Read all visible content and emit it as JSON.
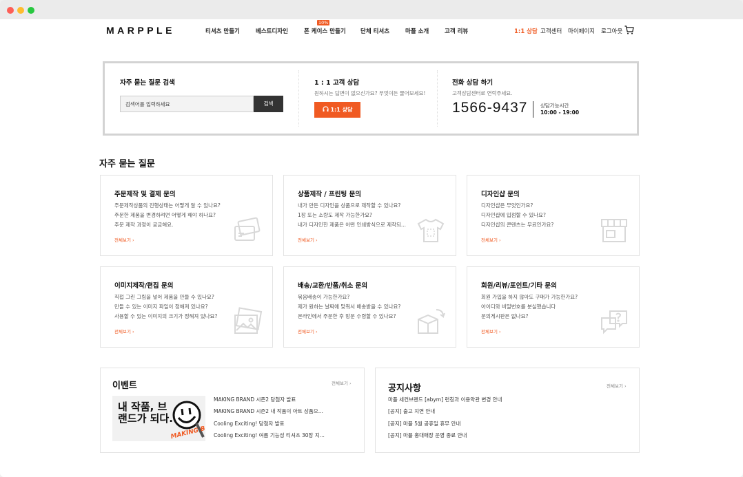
{
  "header": {
    "logo": "MARPPLE",
    "nav": [
      "티셔츠 만들기",
      "베스트디자인",
      "폰 케이스 만들기",
      "단체 티셔츠",
      "마플 소개",
      "고객 리뷰"
    ],
    "nav_badge": "10%",
    "util": [
      "1:1 상담",
      "고객센터",
      "마이페이지",
      "로그아웃"
    ],
    "accent_color": "#f05a22"
  },
  "support": {
    "search_title": "자주 묻는 질문 검색",
    "search_placeholder": "검색어를 입력하세요",
    "search_button": "검색",
    "chat_title": "1 : 1 고객 상담",
    "chat_sub": "원하시는 답변이 없으신가요? 무엇이든 물어보세요!",
    "chat_button": "1:1 상담",
    "phone_title": "전화 상담 하기",
    "phone_sub": "고객상담센터로 연락주세요.",
    "phone_number": "1566-9437",
    "hours_label": "상담가능시간",
    "hours_value": "10:00 - 19:00"
  },
  "faq": {
    "heading": "자주 묻는 질문",
    "more": "전체보기",
    "cards": [
      {
        "title": "주문제작 및 결제 문의",
        "icon": "payment-card-icon",
        "questions": [
          "주문제작상품의 진행상태는 어떻게 알 수 있나요?",
          "주문한 제품을 변경하려면 어떻게 해야 하나요?",
          "주문 제작 과정이 궁금해요."
        ]
      },
      {
        "title": "상품제작 / 프린팅 문의",
        "icon": "tshirt-icon",
        "questions": [
          "내가 만든 디자인을 상품으로 제작할 수 있나요?",
          "1장 또는 소량도 제작 가능한가요?",
          "내가 디자인한 제품은 어떤 인쇄방식으로 제작되..."
        ]
      },
      {
        "title": "디자인샵 문의",
        "icon": "shop-icon",
        "questions": [
          "디자인샵은 무엇인가요?",
          "디자인샵에 입점할 수 있나요?",
          "디자인샵의 콘텐츠는 무료인가요?"
        ]
      },
      {
        "title": "이미지제작/편집 문의",
        "icon": "image-icon",
        "questions": [
          "직접 그린 그림을 넣어 제품을 만들 수 있나요?",
          "만들 수 있는 이미지 파일이 정해져 있나요?",
          "사용할 수 있는 이미지의 크기가 정해져 있나요?"
        ]
      },
      {
        "title": "배송/교환/반품/취소 문의",
        "icon": "box-return-icon",
        "questions": [
          "묶음배송이 가능한가요?",
          "제가 원하는 날짜에 맞춰서 배송받을 수 있나요?",
          "온라인에서 주문한 후 방문 수령할 수 있나요?"
        ]
      },
      {
        "title": "회원/리뷰/포인트/기타 문의",
        "icon": "chat-question-icon",
        "questions": [
          "회원 가입을 하지 않아도 구매가 가능한가요?",
          "아이디와 비밀번호를 분실했습니다",
          "문의게시판은 없나요?"
        ]
      }
    ]
  },
  "events": {
    "title": "이벤트",
    "more": "전체보기",
    "image_text": "내 작품, 브랜드가 되다.",
    "items": [
      "MAKING BRAND 시즌2 당첨자 발표",
      "MAKING BRAND 시즌2 내 작품이 아트 상품으...",
      "Cooling Exciting! 당첨자 발표",
      "Cooling Exciting! 여름 기능성 티셔츠 30장 지..."
    ]
  },
  "notices": {
    "title": "공지사항",
    "more": "전체보기",
    "items": [
      "마플 세컨브랜드 [abym] 런칭과 이용약관 변경 안내",
      "[공지] 출고 지연 안내",
      "[공지] 마플 5월 공휴일 휴무 안내",
      "[공지] 마플 홍대매장 운영 종료 안내"
    ]
  }
}
